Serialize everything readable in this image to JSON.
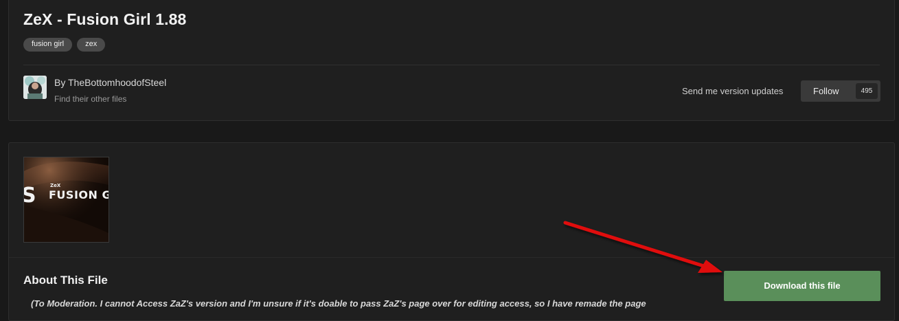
{
  "file": {
    "title": "ZeX - Fusion Girl 1.88",
    "tags": [
      "fusion girl",
      "zex"
    ]
  },
  "author": {
    "by_line": "By TheBottomhoodofSteel",
    "other_files_link": "Find their other files"
  },
  "follow": {
    "updates_label": "Send me version updates",
    "button_label": "Follow",
    "count": "495"
  },
  "thumbnail": {
    "logo_small": "ZeX",
    "logo_text": "FUSION G",
    "logo_mark": "S"
  },
  "about": {
    "heading": "About This File",
    "text": "(To Moderation. I cannot Access ZaZ's version and I'm unsure if it's doable to pass ZaZ's page over for editing access, so I have remade the page"
  },
  "download": {
    "button_label": "Download this file"
  },
  "colors": {
    "download_green": "#5a8f5a",
    "annotation_arrow": "#e01010",
    "background": "#191919",
    "card": "#1f1f1f"
  }
}
